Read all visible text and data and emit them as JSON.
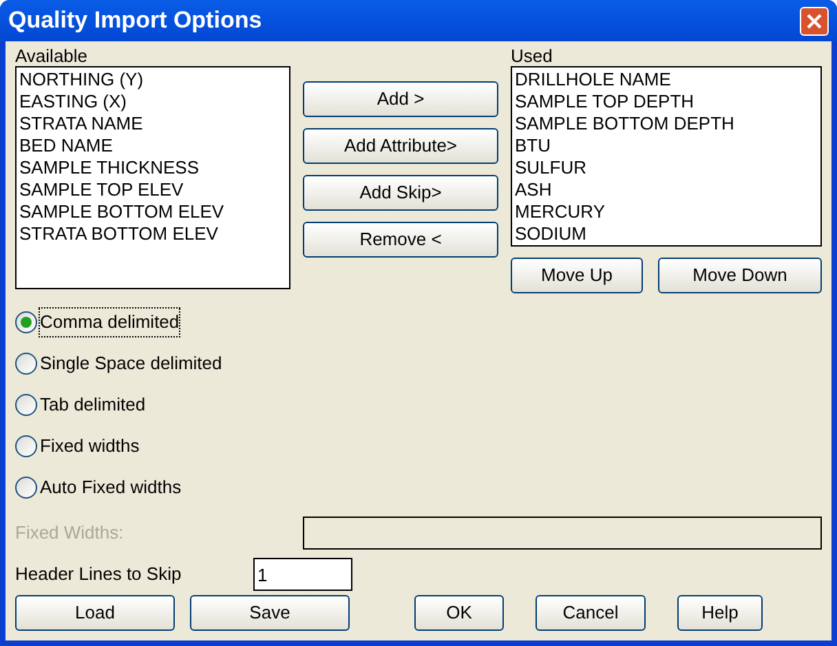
{
  "window": {
    "title": "Quality Import Options"
  },
  "available": {
    "label": "Available",
    "items": [
      "NORTHING (Y)",
      "EASTING (X)",
      "STRATA NAME",
      "BED NAME",
      "SAMPLE THICKNESS",
      "SAMPLE TOP ELEV",
      "SAMPLE BOTTOM ELEV",
      "STRATA BOTTOM ELEV"
    ]
  },
  "transfer_buttons": [
    "Add >",
    "Add Attribute>",
    "Add Skip>",
    "Remove <"
  ],
  "used": {
    "label": "Used",
    "items": [
      "DRILLHOLE NAME",
      "SAMPLE TOP DEPTH",
      "SAMPLE BOTTOM DEPTH",
      "BTU",
      "SULFUR",
      "ASH",
      "MERCURY",
      "SODIUM"
    ]
  },
  "order_buttons": [
    "Move Up",
    "Move Down"
  ],
  "delimiters": [
    {
      "label": "Comma delimited",
      "selected": true
    },
    {
      "label": "Single Space delimited",
      "selected": false
    },
    {
      "label": "Tab delimited",
      "selected": false
    },
    {
      "label": "Fixed widths",
      "selected": false
    },
    {
      "label": "Auto Fixed widths",
      "selected": false
    }
  ],
  "fixed_widths": {
    "label": "Fixed Widths:",
    "disabled": true
  },
  "header_lines": {
    "label": "Header Lines to Skip",
    "value": "1"
  },
  "bottom_buttons": [
    "Load",
    "Save",
    "OK",
    "Cancel",
    "Help"
  ]
}
